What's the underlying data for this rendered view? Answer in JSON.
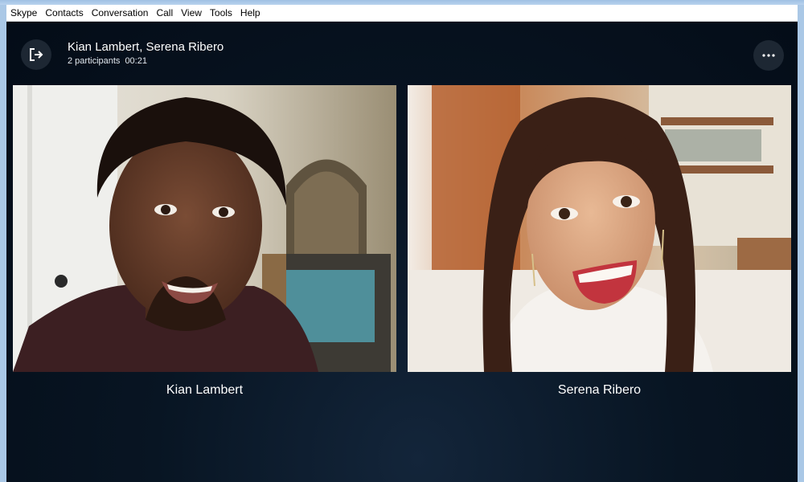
{
  "menu": {
    "items": [
      {
        "label": "Skype"
      },
      {
        "label": "Contacts"
      },
      {
        "label": "Conversation"
      },
      {
        "label": "Call"
      },
      {
        "label": "View"
      },
      {
        "label": "Tools"
      },
      {
        "label": "Help"
      }
    ]
  },
  "call": {
    "title": "Kian Lambert, Serena Ribero",
    "participants_count": "2 participants",
    "duration": "00:21"
  },
  "participants": [
    {
      "name": "Kian Lambert"
    },
    {
      "name": "Serena Ribero"
    }
  ],
  "icons": {
    "leave": "leave-call-icon",
    "more": "more-options-icon"
  },
  "colors": {
    "call_background": "#081523",
    "button_background": "#1d2733",
    "menubar_background": "#ffffff"
  }
}
